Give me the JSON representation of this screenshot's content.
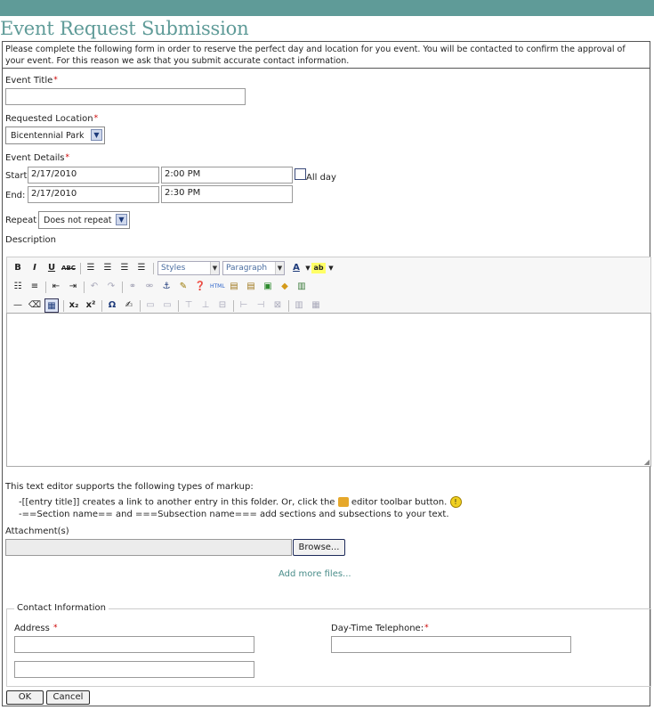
{
  "page": {
    "title": "Event Request Submission"
  },
  "intro": "Please complete the following form in order to reserve the perfect day and location for you event. You will be contacted to confirm the approval of your event. For this reason we ask that you submit accurate contact information.",
  "required_marker": "*",
  "event_title": {
    "label": "Event Title",
    "value": ""
  },
  "location": {
    "label": "Requested Location",
    "value": "Bicentennial Park"
  },
  "details": {
    "label": "Event Details",
    "start_label": "Start:",
    "start_date": "2/17/2010",
    "start_time": "2:00 PM",
    "end_label": "End:",
    "end_date": "2/17/2010",
    "end_time": "2:30 PM",
    "all_day_label": "All day",
    "all_day_checked": false
  },
  "repeat": {
    "label": "Repeat",
    "value": "Does not repeat"
  },
  "description": {
    "label": "Description",
    "value": ""
  },
  "toolbar": {
    "bold": "B",
    "italic": "I",
    "underline": "U",
    "strike": "ABC",
    "styles_placeholder": "Styles",
    "format_value": "Paragraph",
    "subscript": "x₂",
    "superscript": "x²",
    "omega": "Ω",
    "html": "HTML"
  },
  "markup_help": {
    "intro": "This text editor supports the following types of markup:",
    "line1_a": "-[[entry title]] creates a link to another entry in this folder. Or, click the",
    "line1_b": "editor toolbar button.",
    "line2": "-==Section name== and ===Subsection name=== add sections and subsections to your text."
  },
  "attachments": {
    "label": "Attachment(s)",
    "browse_label": "Browse...",
    "add_more_label": "Add more files..."
  },
  "contact": {
    "legend": "Contact Information",
    "address_label": "Address",
    "address_line1": "",
    "address_line2": "",
    "phone_label": "Day-Time Telephone:",
    "phone_value": ""
  },
  "buttons": {
    "ok": "OK",
    "cancel": "Cancel"
  },
  "colors": {
    "header": "#5f9b98",
    "required": "#cc0000",
    "link": "#4a8d8a"
  }
}
